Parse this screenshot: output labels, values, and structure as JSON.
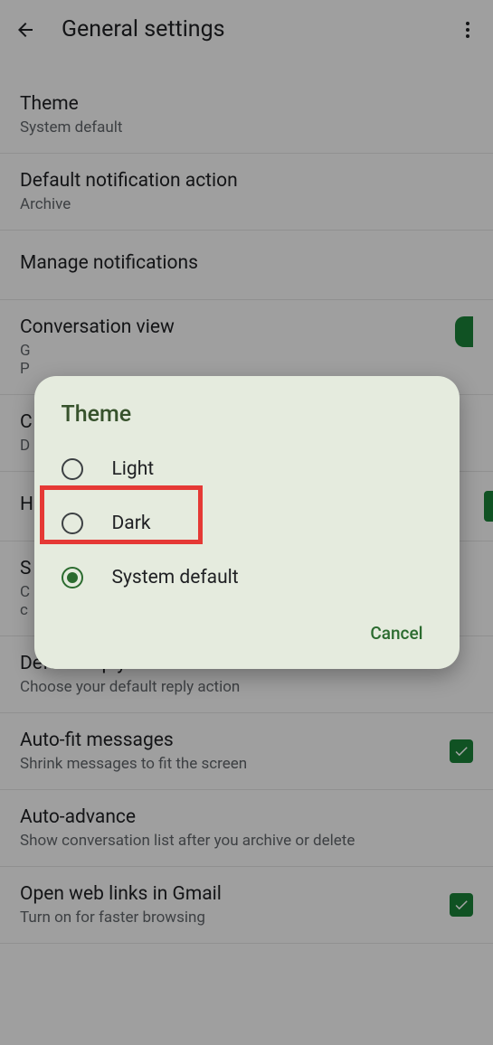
{
  "header": {
    "title": "General settings"
  },
  "settings": {
    "theme": {
      "title": "Theme",
      "value": "System default"
    },
    "notif_action": {
      "title": "Default notification action",
      "value": "Archive"
    },
    "manage_notif": {
      "title": "Manage notifications"
    },
    "conv_view": {
      "title": "Conversation view",
      "sub_partial": "G\nP"
    },
    "c_item": {
      "title": "C",
      "sub": "D"
    },
    "h_item": {
      "title": "H"
    },
    "s_item": {
      "title": "S",
      "sub": "C\nc"
    },
    "default_reply": {
      "title": "Default reply action",
      "sub": "Choose your default reply action"
    },
    "autofit": {
      "title": "Auto-fit messages",
      "sub": "Shrink messages to fit the screen"
    },
    "autoadvance": {
      "title": "Auto-advance",
      "sub": "Show conversation list after you archive or delete"
    },
    "weblinks": {
      "title": "Open web links in Gmail",
      "sub": "Turn on for faster browsing"
    }
  },
  "dialog": {
    "title": "Theme",
    "options": {
      "light": "Light",
      "dark": "Dark",
      "system": "System default"
    },
    "cancel": "Cancel"
  }
}
